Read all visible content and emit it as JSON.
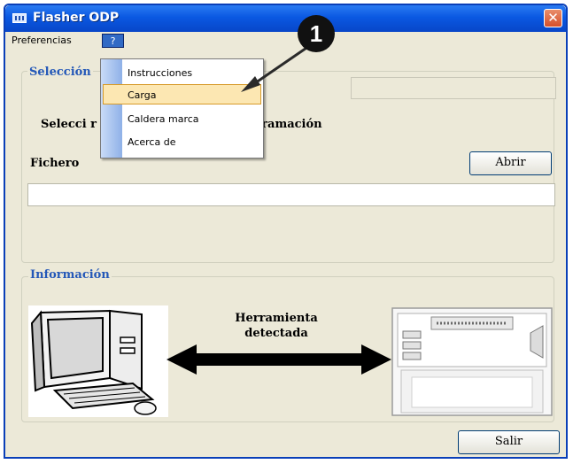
{
  "window": {
    "title": "Flasher ODP"
  },
  "menubar": {
    "preferencias": "Preferencias",
    "help": "?"
  },
  "help_menu": {
    "items": [
      "Instrucciones",
      "Carga",
      "Caldera marca",
      "Acerca de"
    ],
    "highlighted": "Carga"
  },
  "seleccion": {
    "label": "Selección",
    "instruction": "Selecci                             r a la herramienta de programación",
    "fichero_label": "Fichero",
    "file_value": "",
    "abrir_button": "Abrir"
  },
  "informacion": {
    "label": "Información",
    "tool_status_line1": "Herramienta",
    "tool_status_line2": "detectada"
  },
  "footer": {
    "salir_button": "Salir"
  },
  "callout": {
    "number": "1"
  },
  "colors": {
    "titlebar": "#0a58e2",
    "group_label": "#2458b8",
    "menu_highlight": "#fce7b2"
  },
  "icons": [
    "app-icon",
    "close-icon",
    "computer-image",
    "double-arrow",
    "programming-device-image"
  ]
}
